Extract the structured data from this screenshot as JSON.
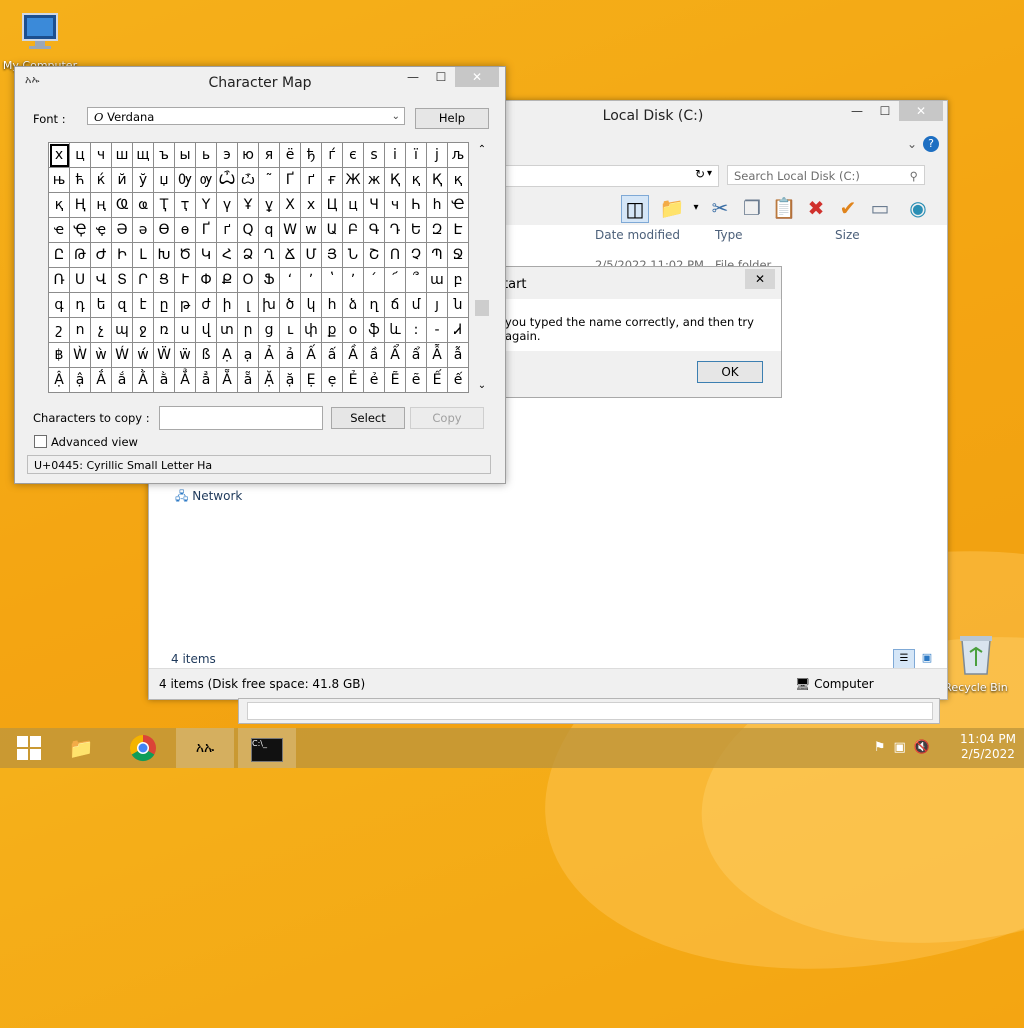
{
  "desktop": {
    "icons": [
      {
        "label": "My Computer"
      },
      {
        "label": "Recycle Bin"
      }
    ]
  },
  "explorer": {
    "title": "Local Disk (C:)",
    "search_placeholder": "Search Local Disk (C:)",
    "columns": [
      "Date modified",
      "Type",
      "Size"
    ],
    "first_row": {
      "date": "2/5/2022 11:02 PM",
      "type": "File folder"
    },
    "nav_network": "Network",
    "items_count": "4 items",
    "status_left": "4 items (Disk free space: 41.8 GB)",
    "status_right": "Computer"
  },
  "error_dialog": {
    "title": "tart",
    "message": "you typed the name correctly, and then try again.",
    "ok_label": "OK"
  },
  "charmap": {
    "title": "Character Map",
    "font_label": "Font :",
    "font_value": "Verdana",
    "help_label": "Help",
    "copy_label": "Characters to copy :",
    "copy_value": "",
    "select_label": "Select",
    "copy_button_label": "Copy",
    "advanced_label": "Advanced view",
    "status": "U+0445: Cyrillic Small Letter Ha",
    "chars": [
      [
        "х",
        "ц",
        "ч",
        "ш",
        "щ",
        "ъ",
        "ы",
        "ь",
        "э",
        "ю",
        "я",
        "ё",
        "ђ",
        "ѓ",
        "є",
        "ѕ",
        "і",
        "ї",
        "ј",
        "љ"
      ],
      [
        "њ",
        "ћ",
        "ќ",
        "й",
        "ў",
        "џ",
        "Ѹ",
        "ѹ",
        "Ѽ",
        "ѽ",
        "˜",
        "Ґ",
        "ґ",
        "ғ",
        "Ж",
        "ж",
        "Қ",
        "қ",
        "Қ",
        "қ"
      ],
      [
        "қ",
        "Ң",
        "ң",
        "Ҩ",
        "ҩ",
        "Ҭ",
        "ҭ",
        "Ү",
        "ү",
        "Ұ",
        "ұ",
        "Х",
        "х",
        "Ц",
        "ц",
        "Ч",
        "ч",
        "Һ",
        "һ",
        "Ҽ"
      ],
      [
        "ҽ",
        "Ҿ",
        "ҿ",
        "Ә",
        "ә",
        "Ө",
        "ө",
        "Ґ",
        "ґ",
        "Q",
        "q",
        "W",
        "w",
        "Ա",
        "Բ",
        "Գ",
        "Դ",
        "Ե",
        "Զ",
        "Է"
      ],
      [
        "Ը",
        "Թ",
        "Ժ",
        "Ի",
        "Լ",
        "Խ",
        "Ծ",
        "Կ",
        "Հ",
        "Ձ",
        "Ղ",
        "Ճ",
        "Մ",
        "Յ",
        "Ն",
        "Շ",
        "Ո",
        "Չ",
        "Պ",
        "Ջ"
      ],
      [
        "Ռ",
        "Ս",
        "Վ",
        "Տ",
        "Ր",
        "Ց",
        "Ւ",
        "Փ",
        "Ք",
        "Օ",
        "Ֆ",
        "ʻ",
        "ʼ",
        "ʽ",
        "՚",
        "՛",
        "՜",
        "՞",
        "ա",
        "բ"
      ],
      [
        "գ",
        "դ",
        "ե",
        "զ",
        "է",
        "ը",
        "թ",
        "ժ",
        "ի",
        "լ",
        "խ",
        "ծ",
        "կ",
        "հ",
        "ձ",
        "ղ",
        "ճ",
        "մ",
        "յ",
        "ն"
      ],
      [
        "շ",
        "ո",
        "չ",
        "պ",
        "ջ",
        "ռ",
        "ս",
        "վ",
        "տ",
        "ր",
        "ց",
        "ւ",
        "փ",
        "ք",
        "օ",
        "ֆ",
        "և",
        ":",
        "-",
        "Ꮧ"
      ],
      [
        "฿",
        "Ẁ",
        "ẁ",
        "Ẃ",
        "ẃ",
        "Ẅ",
        "ẅ",
        "ß",
        "Ạ",
        "ạ",
        "Ả",
        "ả",
        "Ấ",
        "ấ",
        "Ầ",
        "ầ",
        "Ẩ",
        "ẩ",
        "Ẫ",
        "ẫ"
      ],
      [
        "Ậ",
        "ậ",
        "Ắ",
        "ắ",
        "Ằ",
        "ằ",
        "Ẳ",
        "ẳ",
        "Ẵ",
        "ẵ",
        "Ặ",
        "ặ",
        "Ẹ",
        "ẹ",
        "Ẻ",
        "ẻ",
        "Ẽ",
        "ẽ",
        "Ế",
        "ế"
      ]
    ]
  },
  "taskbar": {
    "time": "11:04 PM",
    "date": "2/5/2022"
  }
}
